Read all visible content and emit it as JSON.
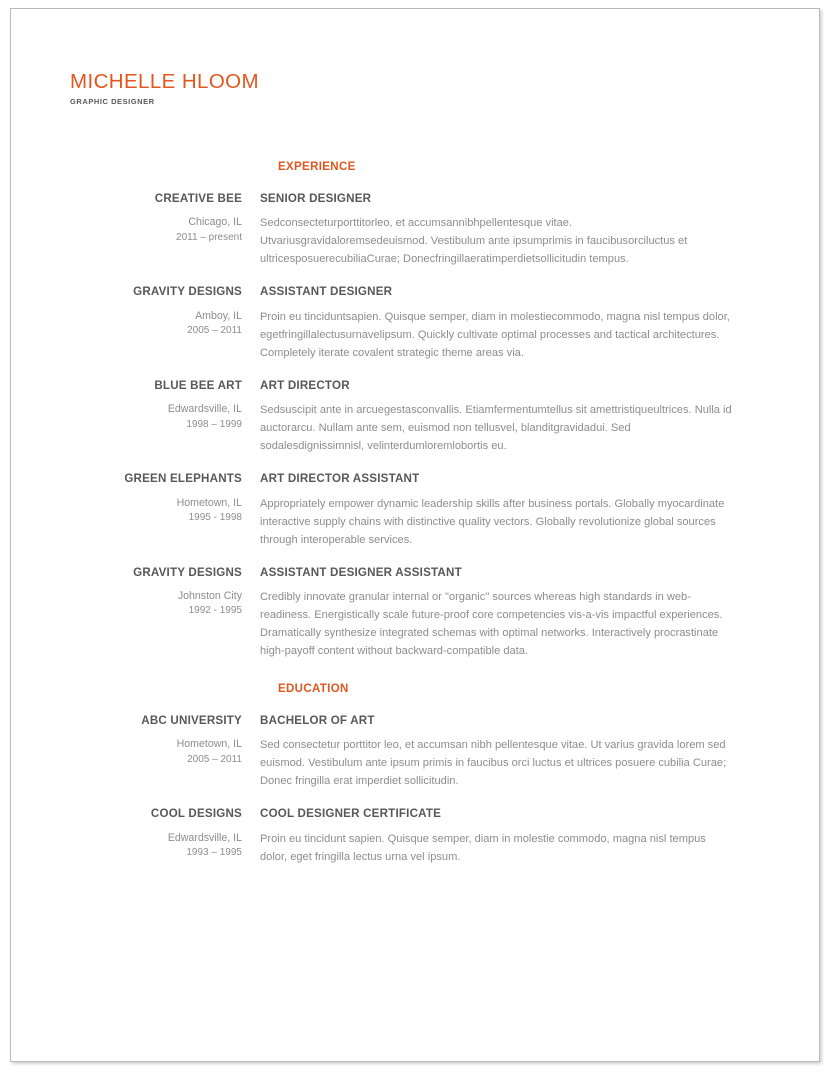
{
  "header": {
    "name": "MICHELLE HLOOM",
    "subtitle": "GRAPHIC DESIGNER",
    "accent_color": "#e0571f",
    "heading_color": "#58585a",
    "body_color": "#8d8d8f"
  },
  "sections": [
    {
      "title": "EXPERIENCE",
      "entries": [
        {
          "org": "CREATIVE BEE",
          "location": "Chicago, IL",
          "dates": "2011 – present",
          "role": "SENIOR DESIGNER",
          "description": "Sedconsecteturporttitorleo, et accumsannibhpellentesque vitae. Utvariusgravidaloremsedeuismod. Vestibulum ante ipsumprimis in faucibusorciluctus et ultricesposuerecubiliaCurae; Donecfringillaeratimperdietsollicitudin tempus."
        },
        {
          "org": "GRAVITY DESIGNS",
          "location": "Amboy, IL",
          "dates": "2005 – 2011",
          "role": "ASSISTANT DESIGNER",
          "description": "Proin eu tinciduntsapien. Quisque semper, diam in molestiecommodo, magna nisl tempus dolor, egetfringillalectusurnavelipsum. Quickly cultivate optimal processes and tactical architectures. Completely iterate covalent strategic theme areas via."
        },
        {
          "org": "BLUE BEE ART",
          "location": "Edwardsville, IL",
          "dates": "1998 – 1999",
          "role": "ART DIRECTOR",
          "description": "Sedsuscipit ante in arcuegestasconvallis. Etiamfermentumtellus sit amettristiqueultrices. Nulla id auctorarcu. Nullam ante sem, euismod non tellusvel, blanditgravidadui. Sed sodalesdignissimnisl, velinterdumloremlobortis eu."
        },
        {
          "org": "GREEN ELEPHANTS",
          "location": "Hometown, IL",
          "dates": "1995 - 1998",
          "role": "ART DIRECTOR ASSISTANT",
          "description": "Appropriately empower dynamic leadership skills after business portals. Globally myocardinate interactive supply chains with distinctive quality vectors. Globally revolutionize global sources through interoperable services."
        },
        {
          "org": "GRAVITY DESIGNS",
          "location": "Johnston City",
          "dates": "1992 - 1995",
          "role": "ASSISTANT DESIGNER ASSISTANT",
          "description": "Credibly innovate granular internal or \"organic\" sources whereas high standards in web-readiness. Energistically scale future-proof core competencies vis-a-vis impactful experiences. Dramatically synthesize integrated schemas with optimal networks. Interactively procrastinate high-payoff content without backward-compatible data."
        }
      ]
    },
    {
      "title": "EDUCATION",
      "entries": [
        {
          "org": "ABC UNIVERSITY",
          "location": "Hometown, IL",
          "dates": "2005 – 2011",
          "role": "BACHELOR OF ART",
          "description": "Sed consectetur porttitor leo, et accumsan nibh pellentesque vitae. Ut varius gravida lorem sed euismod. Vestibulum ante ipsum primis in faucibus orci luctus et ultrices posuere cubilia Curae; Donec fringilla erat imperdiet sollicitudin."
        },
        {
          "org": "COOL DESIGNS",
          "location": "Edwardsville, IL",
          "dates": "1993 – 1995",
          "role": "COOL DESIGNER CERTIFICATE",
          "description": "Proin eu tincidunt sapien. Quisque semper, diam in molestie commodo, magna nisl tempus dolor, eget fringilla lectus urna vel ipsum."
        }
      ]
    }
  ]
}
